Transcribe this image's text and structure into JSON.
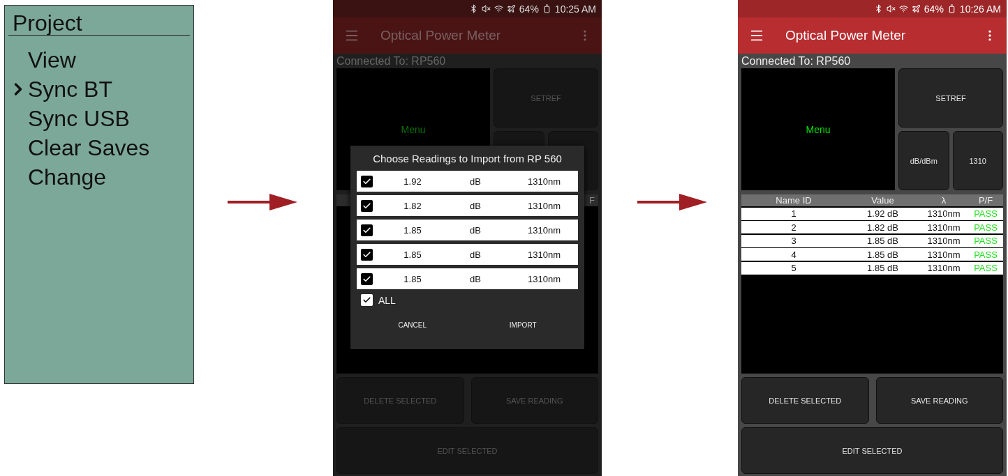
{
  "device_menu": {
    "title": "Project",
    "items": [
      {
        "label": "View",
        "selected": false
      },
      {
        "label": "Sync BT",
        "selected": true
      },
      {
        "label": "Sync USB",
        "selected": false
      },
      {
        "label": "Clear Saves",
        "selected": false
      },
      {
        "label": "Change",
        "selected": false
      }
    ]
  },
  "phones": [
    {
      "dimmed": true,
      "status_bar": {
        "battery": "64%",
        "time": "10:25 AM"
      },
      "app_bar": {
        "title": "Optical Power Meter"
      },
      "connection": "Connected To: RP560",
      "display": {
        "label": "Menu"
      },
      "setref": "SETREF",
      "table_header_fragment": "F",
      "actions": [
        "DELETE SELECTED",
        "SAVE READING",
        "EDIT SELECTED"
      ],
      "dialog": {
        "title": "Choose Readings to Import from RP 560",
        "rows": [
          {
            "checked": true,
            "value": "1.92",
            "unit": "dB",
            "wavelength": "1310nm"
          },
          {
            "checked": true,
            "value": "1.82",
            "unit": "dB",
            "wavelength": "1310nm"
          },
          {
            "checked": true,
            "value": "1.85",
            "unit": "dB",
            "wavelength": "1310nm"
          },
          {
            "checked": true,
            "value": "1.85",
            "unit": "dB",
            "wavelength": "1310nm"
          },
          {
            "checked": true,
            "value": "1.85",
            "unit": "dB",
            "wavelength": "1310nm"
          }
        ],
        "all": {
          "label": "ALL",
          "checked": true
        },
        "buttons": [
          "CANCEL",
          "IMPORT"
        ]
      }
    },
    {
      "dimmed": false,
      "status_bar": {
        "battery": "64%",
        "time": "10:26 AM"
      },
      "app_bar": {
        "title": "Optical Power Meter"
      },
      "connection": "Connected To: RP560",
      "display": {
        "label": "Menu"
      },
      "setref": "SETREF",
      "unit_button": "dB/dBm",
      "wavelength_button": "1310",
      "actions": [
        "DELETE SELECTED",
        "SAVE READING",
        "EDIT SELECTED"
      ],
      "table": {
        "columns": [
          "Name ID",
          "Value",
          "λ",
          "P/F"
        ],
        "rows": [
          {
            "name_id": "1",
            "value": "1.92 dB",
            "wavelength": "1310nm",
            "result": "PASS"
          },
          {
            "name_id": "2",
            "value": "1.82 dB",
            "wavelength": "1310nm",
            "result": "PASS"
          },
          {
            "name_id": "3",
            "value": "1.85 dB",
            "wavelength": "1310nm",
            "result": "PASS"
          },
          {
            "name_id": "4",
            "value": "1.85 dB",
            "wavelength": "1310nm",
            "result": "PASS"
          },
          {
            "name_id": "5",
            "value": "1.85 dB",
            "wavelength": "1310nm",
            "result": "PASS"
          }
        ]
      }
    }
  ]
}
